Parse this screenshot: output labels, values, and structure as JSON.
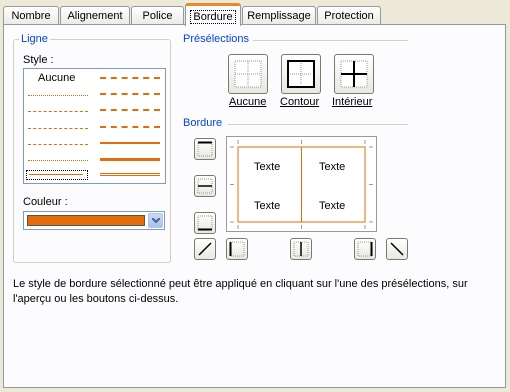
{
  "tabs": [
    {
      "label": "Nombre"
    },
    {
      "label": "Alignement"
    },
    {
      "label": "Police"
    },
    {
      "label": "Bordure",
      "active": true
    },
    {
      "label": "Remplissage"
    },
    {
      "label": "Protection"
    }
  ],
  "ligne": {
    "group_title": "Ligne",
    "style_label": "Style :",
    "none_label": "Aucune",
    "color_label": "Couleur :",
    "color_value": "#e46c0a"
  },
  "presets": {
    "title": "Présélections",
    "items": [
      {
        "label": "Aucune"
      },
      {
        "label": "Contour"
      },
      {
        "label": "Intérieur"
      }
    ]
  },
  "border": {
    "title": "Bordure",
    "preview_text": "Texte"
  },
  "description": "Le style de bordure sélectionné peut être appliqué en cliquant sur l'une des présélections, sur l'aperçu ou les boutons ci-dessus.",
  "colors": {
    "accent": "#e46c0a",
    "group_title": "#0046d5",
    "tab_highlight": "#e68b2c"
  },
  "icons": [
    "chevron-down-icon",
    "border-none-icon",
    "border-outline-icon",
    "border-inside-icon"
  ]
}
